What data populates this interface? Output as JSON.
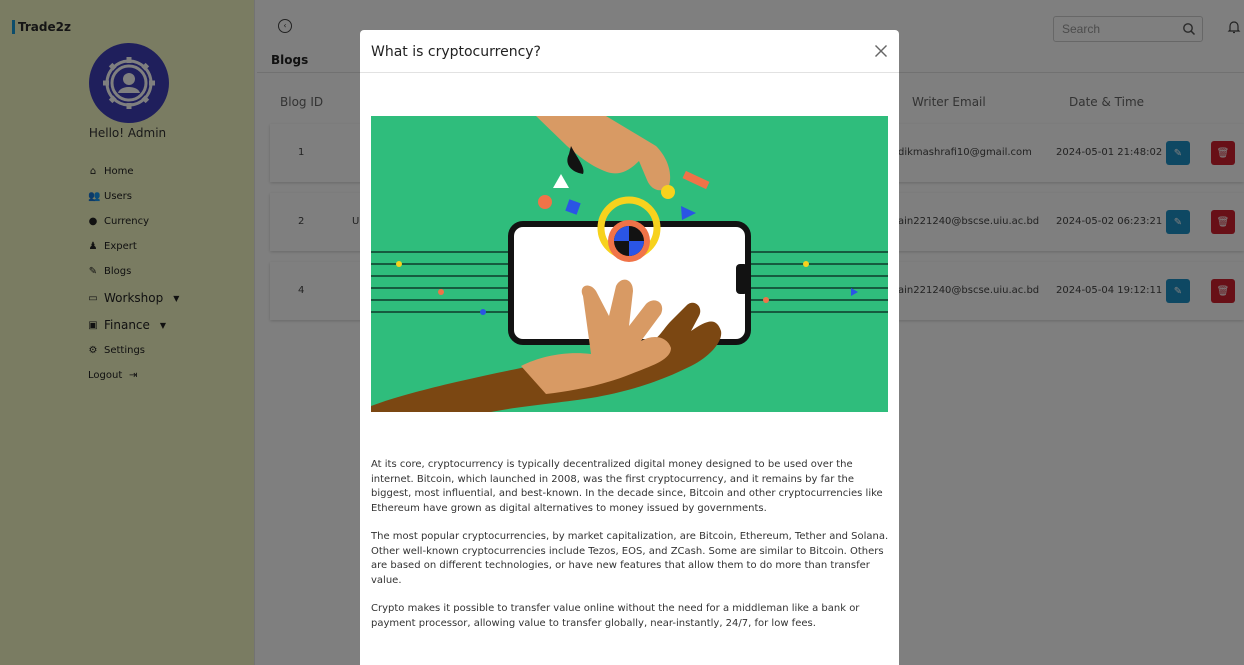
{
  "app": {
    "brand": "Trade2z",
    "greeting": "Hello!  Admin"
  },
  "sidebar": {
    "items": [
      {
        "label": "Home",
        "icon": "home-icon"
      },
      {
        "label": "Users",
        "icon": "users-icon"
      },
      {
        "label": "Currency",
        "icon": "currency-icon"
      },
      {
        "label": "Expert",
        "icon": "expert-icon"
      },
      {
        "label": "Blogs",
        "icon": "blogs-icon"
      },
      {
        "label": "Workshop",
        "icon": "workshop-icon"
      },
      {
        "label": "Finance",
        "icon": "finance-icon"
      },
      {
        "label": "Settings",
        "icon": "settings-icon"
      },
      {
        "label": "Logout",
        "icon": "logout-icon"
      }
    ]
  },
  "header": {
    "search_placeholder": "Search"
  },
  "page": {
    "title": "Blogs"
  },
  "table": {
    "headers": [
      "Blog ID",
      "Writer Email",
      "Date & Time"
    ],
    "rows": [
      {
        "id": "1",
        "title_fragment": "",
        "email": "dikmashrafi10@gmail.com",
        "datetime": "2024-05-01 21:48:02"
      },
      {
        "id": "2",
        "title_fragment": "U",
        "email": "ain221240@bscse.uiu.ac.bd",
        "datetime": "2024-05-02 06:23:21"
      },
      {
        "id": "4",
        "title_fragment": "",
        "email": "ain221240@bscse.uiu.ac.bd",
        "datetime": "2024-05-04 19:12:11"
      }
    ]
  },
  "modal": {
    "title": "What is cryptocurrency?",
    "paragraphs": [
      "At its core, cryptocurrency is typically decentralized digital money designed to be used over the internet. Bitcoin, which launched in 2008, was the first cryptocurrency, and it remains by far the biggest, most influential, and best-known. In the decade since, Bitcoin and other cryptocurrencies like Ethereum have grown as digital alternatives to money issued by governments.",
      "The most popular cryptocurrencies, by market capitalization, are Bitcoin, Ethereum, Tether and Solana. Other well-known cryptocurrencies include Tezos, EOS, and ZCash. Some are similar to Bitcoin. Others are based on different technologies, or have new features that allow them to do more than transfer value.",
      "Crypto makes it possible to transfer value online without the need for a middleman like a bank or payment processor, allowing value to transfer globally, near-instantly, 24/7, for low fees."
    ]
  },
  "colors": {
    "sidebar_bg": "#f5f8c5",
    "accent_blue": "#1d90c6",
    "danger_red": "#d0202e",
    "avatar_blue": "#3e3eb9",
    "illustration_green": "#2fbd7c"
  }
}
